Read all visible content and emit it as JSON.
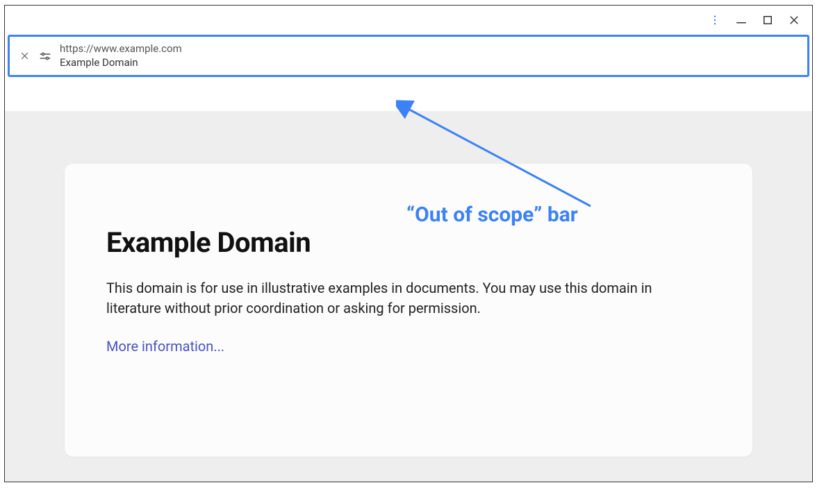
{
  "urlbar": {
    "url": "https://www.example.com",
    "page_title": "Example Domain"
  },
  "page": {
    "heading": "Example Domain",
    "paragraph": "This domain is for use in illustrative examples in documents. You may use this domain in literature without prior coordination or asking for permission.",
    "link_text": "More information..."
  },
  "annotation": {
    "label": "“Out of scope” bar"
  }
}
